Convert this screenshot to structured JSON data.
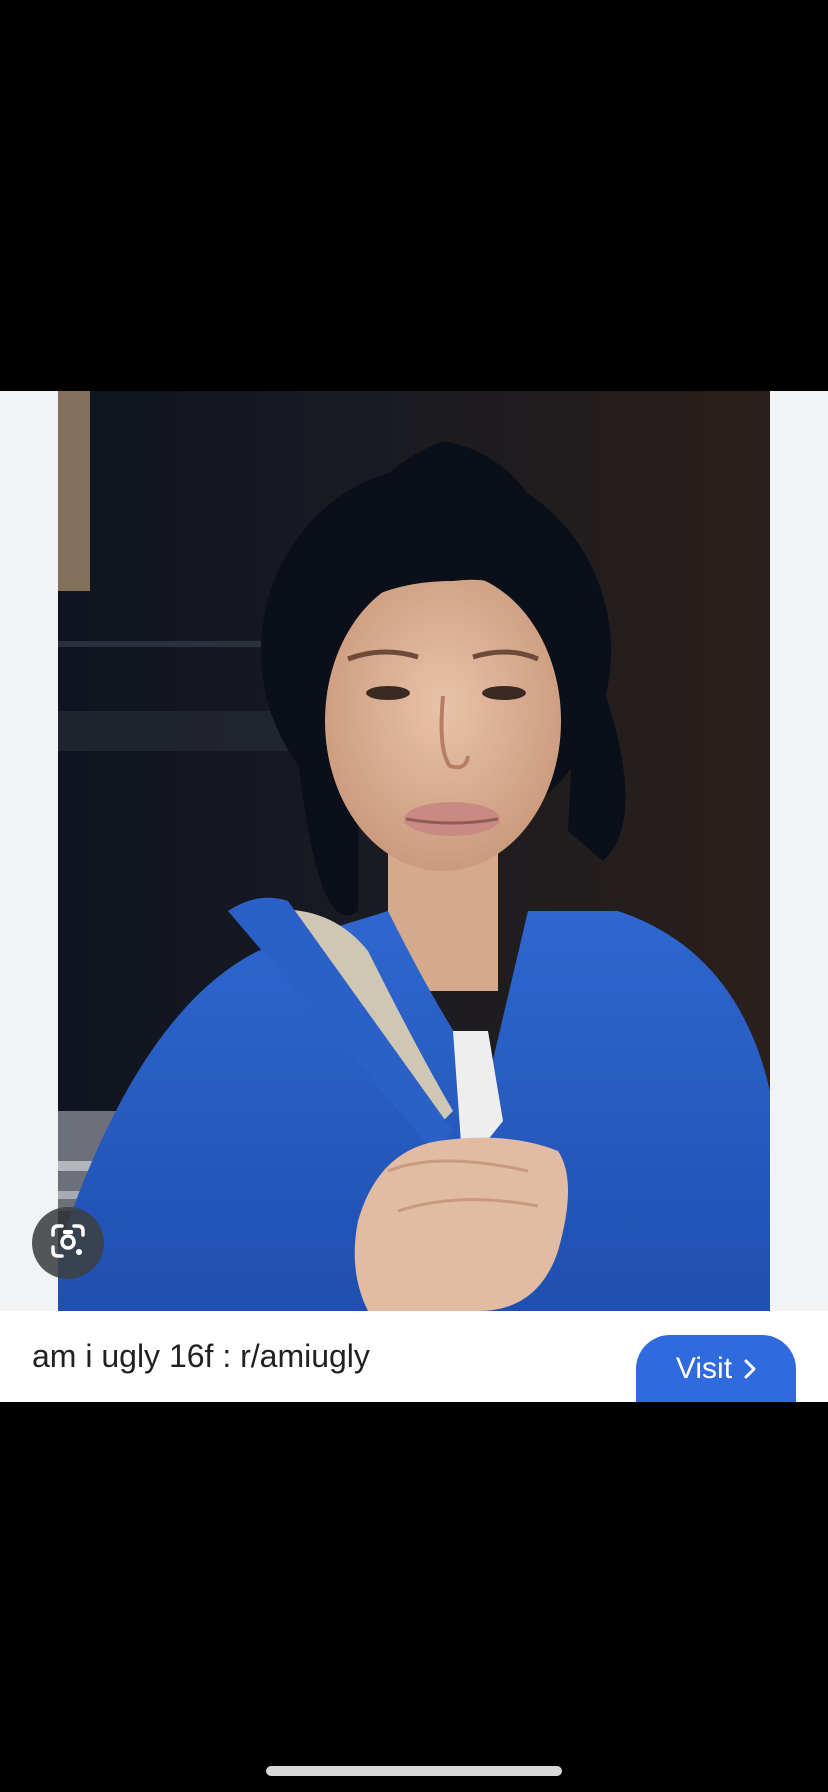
{
  "result": {
    "title": "am i ugly 16f : r/amiugly",
    "visit_label": "Visit"
  },
  "icons": {
    "lens": "google-lens-icon",
    "chevron": "chevron-right-icon"
  },
  "colors": {
    "visit_button": "#2f6bdc",
    "page_background": "#000000",
    "stage_background": "#f1f3f4"
  }
}
